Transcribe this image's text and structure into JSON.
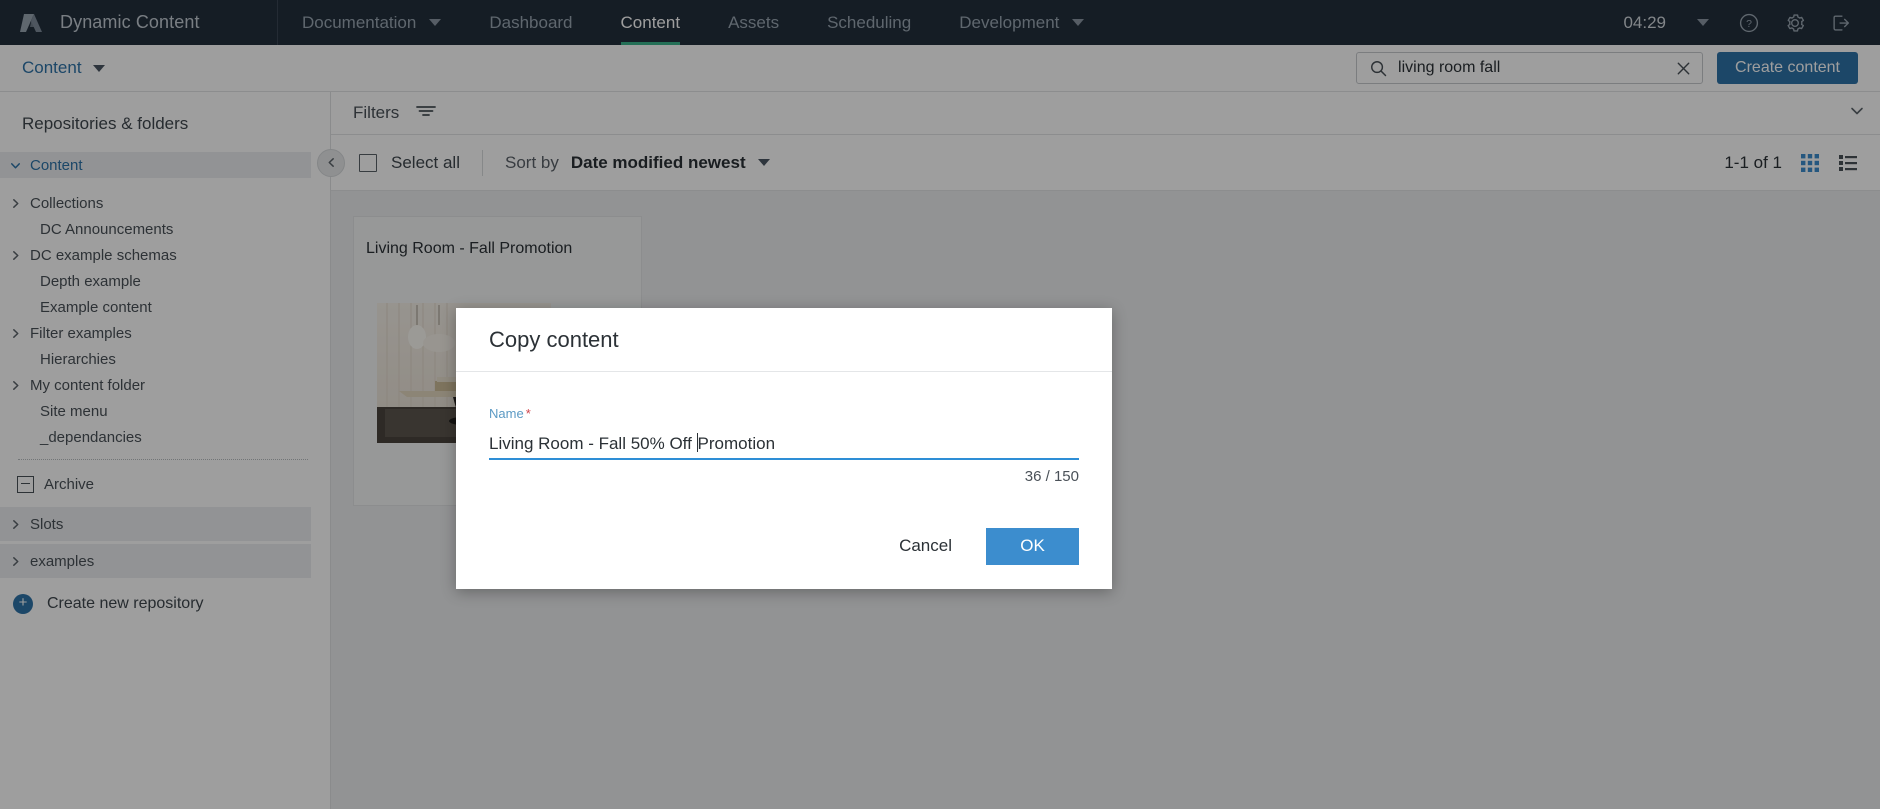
{
  "topnav": {
    "brand": "Dynamic Content",
    "logo_icon": "amplience-logo-icon",
    "items": [
      {
        "label": "Documentation",
        "has_caret": true,
        "active": false
      },
      {
        "label": "Dashboard",
        "has_caret": false,
        "active": false
      },
      {
        "label": "Content",
        "has_caret": false,
        "active": true
      },
      {
        "label": "Assets",
        "has_caret": false,
        "active": false
      },
      {
        "label": "Scheduling",
        "has_caret": false,
        "active": false
      },
      {
        "label": "Development",
        "has_caret": true,
        "active": false
      }
    ],
    "clock": "04:29",
    "clock_caret_icon": "chevron-down-icon",
    "help_icon": "help-circle-icon",
    "settings_icon": "gear-icon",
    "logout_icon": "logout-icon",
    "accent_active": "#3bb38b",
    "background": "#222f3d"
  },
  "subbar": {
    "breadcrumb": "Content",
    "breadcrumb_caret_icon": "caret-down-icon",
    "search": {
      "value": "living room fall",
      "placeholder": "Search",
      "search_icon": "search-icon",
      "clear_icon": "clear-x-icon"
    },
    "create_button": "Create content",
    "create_button_color": "#2e73a8"
  },
  "sidebar": {
    "heading": "Repositories & folders",
    "tree": [
      {
        "label": "Content",
        "icon": "chevron-down-icon",
        "indent": 1,
        "shaded": true,
        "selected": true
      },
      {
        "label": "Collections",
        "icon": "chevron-right-icon",
        "indent": 1,
        "shaded": false,
        "selected": false
      },
      {
        "label": "DC Announcements",
        "icon": "none",
        "indent": 2,
        "shaded": false,
        "selected": false
      },
      {
        "label": "DC example schemas",
        "icon": "chevron-right-icon",
        "indent": 1,
        "shaded": false,
        "selected": false
      },
      {
        "label": "Depth example",
        "icon": "none",
        "indent": 2,
        "shaded": false,
        "selected": false
      },
      {
        "label": "Example content",
        "icon": "none",
        "indent": 2,
        "shaded": false,
        "selected": false
      },
      {
        "label": "Filter examples",
        "icon": "chevron-right-icon",
        "indent": 1,
        "shaded": false,
        "selected": false
      },
      {
        "label": "Hierarchies",
        "icon": "none",
        "indent": 2,
        "shaded": false,
        "selected": false
      },
      {
        "label": "My content folder",
        "icon": "chevron-right-icon",
        "indent": 1,
        "shaded": false,
        "selected": false
      },
      {
        "label": "Site menu",
        "icon": "none",
        "indent": 2,
        "shaded": false,
        "selected": false
      },
      {
        "label": "_dependancies",
        "icon": "none",
        "indent": 2,
        "shaded": false,
        "selected": false
      }
    ],
    "archive": {
      "label": "Archive",
      "icon": "archive-box-minus-icon"
    },
    "repos": [
      {
        "label": "Slots",
        "icon": "chevron-right-icon"
      },
      {
        "label": "examples",
        "icon": "chevron-right-icon"
      }
    ],
    "create_repo": {
      "label": "Create new repository",
      "icon": "plus-circle-icon"
    }
  },
  "main": {
    "filters": {
      "label": "Filters",
      "icon": "filter-icon"
    },
    "panel_collapse_icon": "chevron-down-icon",
    "toolbar": {
      "collapse_icon": "chevron-left-icon",
      "select_all": "Select all",
      "sort_by_label": "Sort by",
      "sort_by_value": "Date modified newest",
      "sort_caret_icon": "caret-down-icon",
      "pagination": "1-1 of 1",
      "grid_view_icon": "grid-view-icon",
      "list_view_icon": "list-view-icon",
      "active_view": "grid"
    },
    "cards": [
      {
        "title": "Living Room - Fall Promotion",
        "thumbnail_alt": "living-room-interior-thumbnail"
      }
    ]
  },
  "modal": {
    "title": "Copy content",
    "field": {
      "label": "Name",
      "required_marker": "*",
      "value_before_caret": "Living Room - Fall 50% Off ",
      "value_after_caret": "Promotion",
      "full_value": "Living Room - Fall 50% Off Promotion",
      "char_count": "36 / 150",
      "underline_color": "#2e8ed6"
    },
    "cancel_label": "Cancel",
    "ok_label": "OK",
    "ok_color": "#3c8dce"
  }
}
